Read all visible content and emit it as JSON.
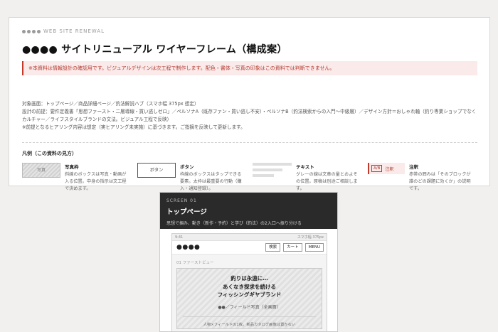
{
  "doc": {
    "eyebrow": "WEB SITE RENEWAL",
    "title": "●●●● サイトリニューアル ワイヤーフレーム（構成案）",
    "notice": "※本資料は情報設計の確認用です。ビジュアルデザインは次工程で制作します。配色・書体・写真の印象はこの資料では判断できません。",
    "meta": [
      "対象画面：トップページ／商品詳細ページ／釣法解説ハブ（スマホ幅 375px 想定）",
      "設計の前提：要件定義書「思想ファースト・二層導線・買い逃しゼロ」／ペルソナA（既存ファン・買い逃し不安）・ペルソナB（釣法検索からの入門〜中級層）／デザイン方針＝おしゃれ軸（釣り専業ショップでなくカルチャー／ライフスタイルブランドの文法。ビジュアル工程で反映）",
      "※前提となるヒアリング内容は想定（実ヒアリング未実施）に基づきます。ご指摘を反映して更新します。"
    ]
  },
  "legend": {
    "title": "凡例（この資料の見方）",
    "items": [
      {
        "swatch": "写真",
        "title": "写真枠",
        "desc": [
          "斜線のボックスは写真・動画が",
          "入る位置。中身の指示は文工程",
          "で決めます。"
        ]
      },
      {
        "swatch": "ボタン",
        "title": "ボタン",
        "desc": [
          "枠線のボックスはタップできる",
          "要素。太枠は最重要の行動（購",
          "入・通知登録）。"
        ]
      },
      {
        "swatch": "",
        "title": "テキスト",
        "desc": [
          "グレーの線は文章の量とおよそ",
          "の位置。原稿は別途ご相談しま",
          "す。"
        ]
      },
      {
        "swatch": "注釈",
        "tag": "A/B",
        "title": "注釈",
        "desc": [
          "赤帯の囲みは「そのブロックが",
          "誰のどの課題に効くか」の説明",
          "です。"
        ]
      }
    ]
  },
  "screen": {
    "label": "SCREEN 01",
    "name": "トップページ",
    "sub": "思想で掴み、動き（新作・予約）と学び（釣法）の2入口へ振り分ける",
    "phone": {
      "time": "9:41",
      "width_note": "スマホ幅 375px",
      "logo": "●●●●",
      "nav": [
        "検索",
        "カート",
        "MENU"
      ],
      "section": "01 ファーストビュー",
      "headline": [
        "釣りは永遠に…",
        "あくなき探求を続ける",
        "フィッシングギヤブランド"
      ],
      "photo_note": "●●／フィールド写真（全画面）",
      "caption": "人物×フィールドの1枚。新品カタログ画像は置かない"
    }
  }
}
